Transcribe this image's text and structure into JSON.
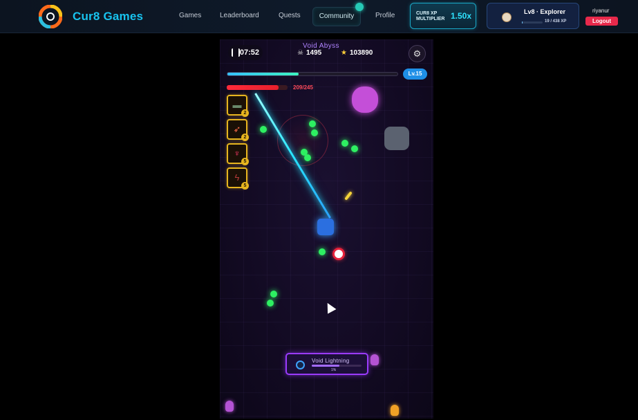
{
  "nav": {
    "brand": "Cur8 Games",
    "links": [
      "Games",
      "Leaderboard",
      "Quests"
    ],
    "community": "Community",
    "profile": "Profile",
    "xp_multiplier_label": "CUR8 XP MULTIPLIER",
    "xp_multiplier_value": "1.50x",
    "user_level": "Lv8 · Explorer",
    "user_xp": "19 / 438 XP",
    "user_xp_progress": 0.04,
    "username": "riyanur",
    "logout": "Logout"
  },
  "hud": {
    "timer": "07:52",
    "level_title": "Void Abyss",
    "kills": "1495",
    "score": "103890",
    "xp_progress": 0.42,
    "level_badge": "Lv.15",
    "hp_text": "209/245",
    "hp_progress": 0.853,
    "slots": [
      {
        "icon": "gun",
        "count": "2"
      },
      {
        "icon": "rocket",
        "count": "2"
      },
      {
        "icon": "demon",
        "count": "5"
      },
      {
        "icon": "lightning",
        "count": "5"
      }
    ],
    "ability": {
      "name": "Void Lightning",
      "pct": "1%",
      "progress": 0.55
    }
  },
  "colors": {
    "brand": "#18c3ef",
    "accent_cyan": "#2fe3ff",
    "logout_red": "#e8294b",
    "slot_gold": "#e7b51f",
    "level_purple": "#b083ff"
  }
}
